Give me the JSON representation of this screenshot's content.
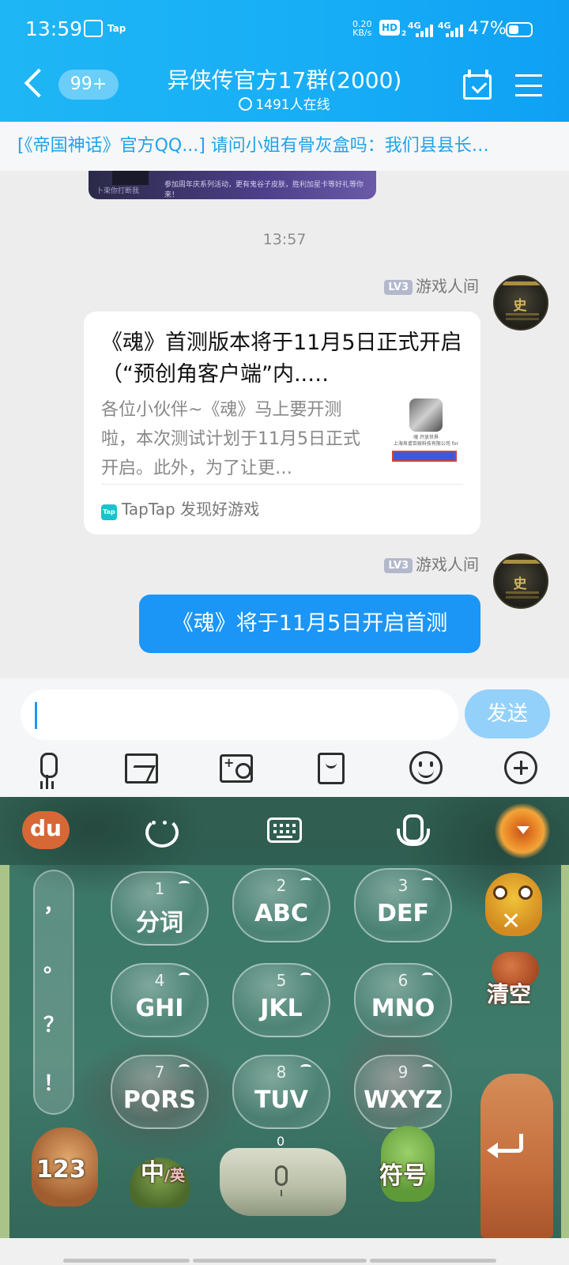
{
  "status_bar": {
    "time": "13:59",
    "speed": "0.20",
    "speed_unit": "KB/s",
    "hd": "HD",
    "hd_sub": "2",
    "net1": "4G",
    "net2": "4G",
    "battery": "47%",
    "battery_level": 0.47,
    "tap_label": "Tap"
  },
  "header": {
    "back_badge": "99+",
    "title": "异侠传官方17群(2000)",
    "online": "1491人在线"
  },
  "notice": {
    "text": "[《帝国神话》官方QQ...] 请问小姐有骨灰盒吗：我们县县长…"
  },
  "prev_card": {
    "left_text": "卜束你打断我",
    "right_text": "参加周年庆系列活动，更有鬼谷子皮肤，胜利加星卡等好礼等你来！"
  },
  "chat": {
    "timestamp": "13:57",
    "messages": [
      {
        "level": "LV3",
        "sender": "游戏人间",
        "avatar_text": "史",
        "card": {
          "title": "《魂》首测版本将于11月5日正式开启（“预创角客户端”内..…",
          "desc": "各位小伙伴~《魂》马上要开测啦，本次测试计划于11月5日正式开启。此外，为了让更…",
          "thumb_text": "魂 开放世界",
          "thumb_text2": "上海帛鳶百娱科技有限公司 for",
          "source": "TapTap 发现好游戏",
          "source_icon": "Tap"
        }
      },
      {
        "level": "LV3",
        "sender": "游戏人间",
        "avatar_text": "史",
        "text": "《魂》将于11月5日开启首测"
      }
    ]
  },
  "input": {
    "value": "",
    "send_label": "发送",
    "tools": [
      "mic-icon",
      "image-icon",
      "camera-icon",
      "red-packet-icon",
      "emoji-icon",
      "plus-icon"
    ]
  },
  "keyboard": {
    "brand": "du",
    "punctuation": [
      "，",
      "。",
      "？",
      "！"
    ],
    "keys": [
      {
        "num": "1",
        "label": "分词"
      },
      {
        "num": "2",
        "label": "ABC"
      },
      {
        "num": "3",
        "label": "DEF"
      },
      {
        "num": "4",
        "label": "GHI"
      },
      {
        "num": "5",
        "label": "JKL"
      },
      {
        "num": "6",
        "label": "MNO"
      },
      {
        "num": "7",
        "label": "PQRS"
      },
      {
        "num": "8",
        "label": "TUV"
      },
      {
        "num": "9",
        "label": "WXYZ"
      }
    ],
    "clear_label": "清空",
    "num_label": "123",
    "lang_main": "中",
    "lang_alt": "/英",
    "space_num": "0",
    "symbol_label": "符号"
  }
}
